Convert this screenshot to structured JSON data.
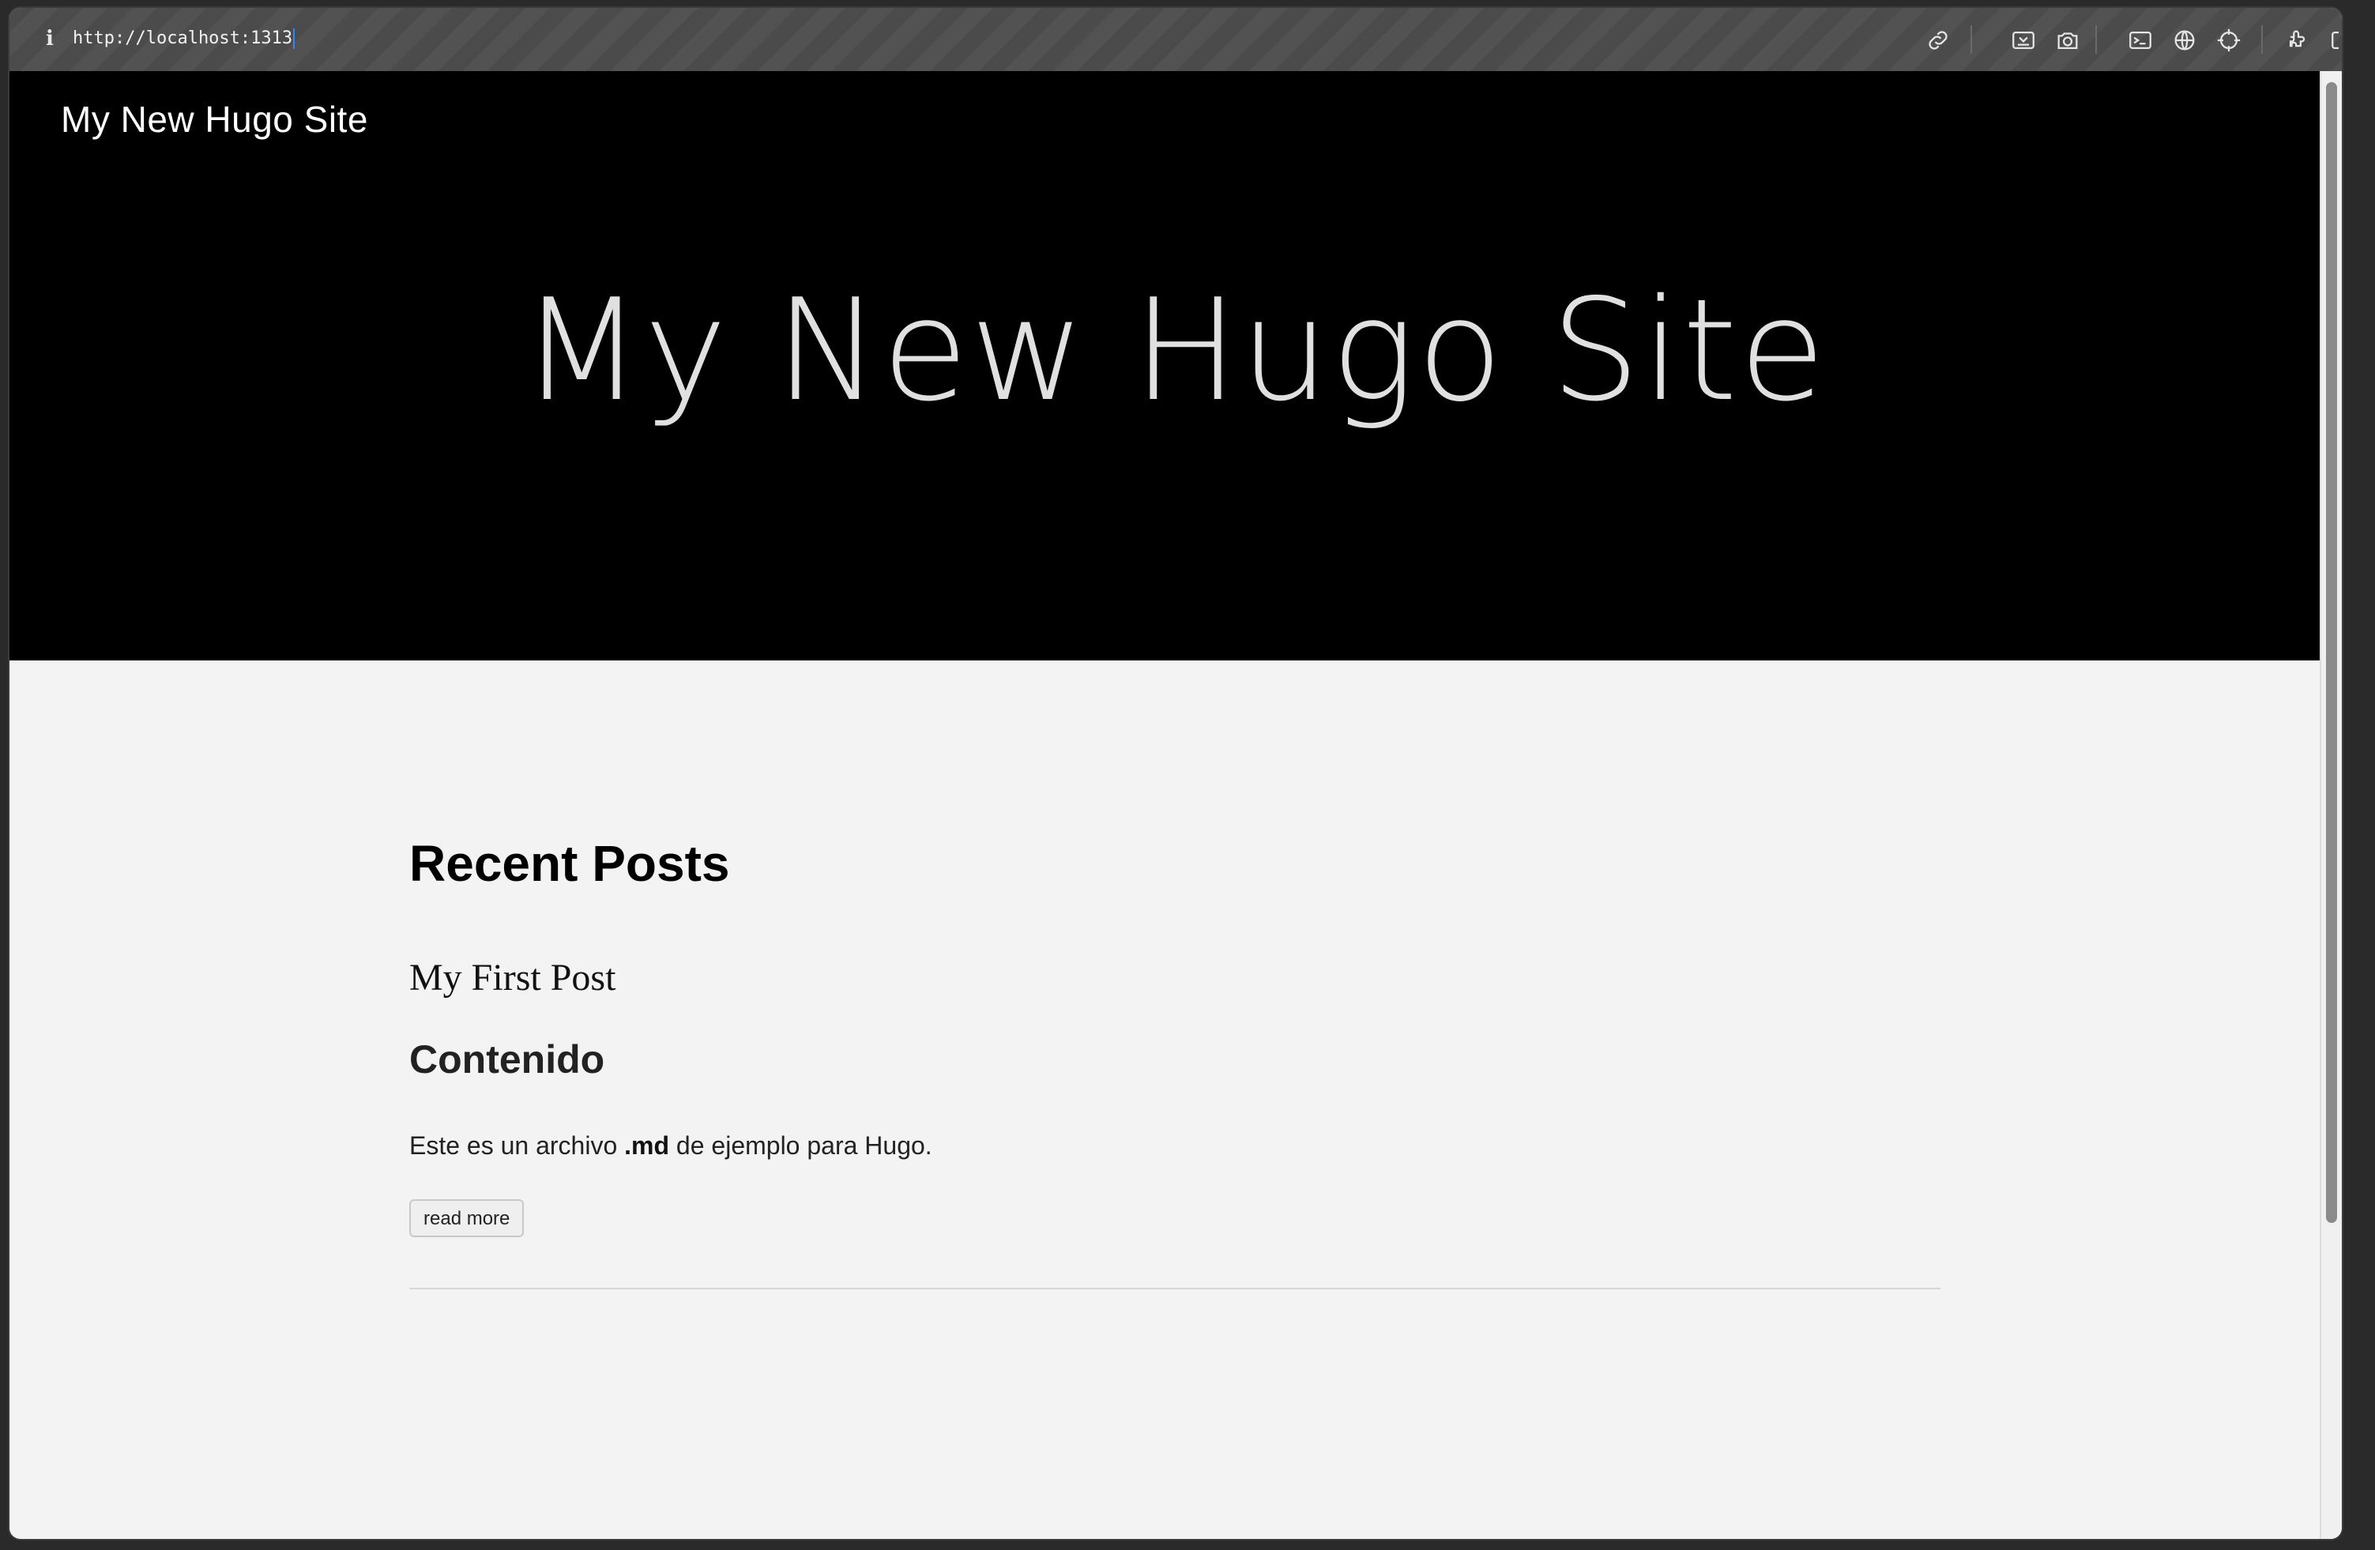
{
  "browser": {
    "url": "http://localhost:1313",
    "icons": [
      "info-icon",
      "link-icon",
      "screenshot-region-icon",
      "camera-icon",
      "terminal-icon",
      "globe-icon",
      "crosshair-icon",
      "extensions-icon",
      "sidebar-icon"
    ]
  },
  "site": {
    "brand": "My New Hugo Site",
    "hero_title": "My New Hugo Site"
  },
  "main": {
    "section_title": "Recent Posts",
    "posts": [
      {
        "title": "My First Post",
        "heading": "Contenido",
        "summary_before": "Este es un archivo ",
        "summary_bold": ".md",
        "summary_after": " de ejemplo para Hugo.",
        "read_more": "read more"
      }
    ]
  },
  "colors": {
    "hero_bg": "#000000",
    "page_bg": "#f3f3f3",
    "accent_caret": "#3b82f6"
  }
}
